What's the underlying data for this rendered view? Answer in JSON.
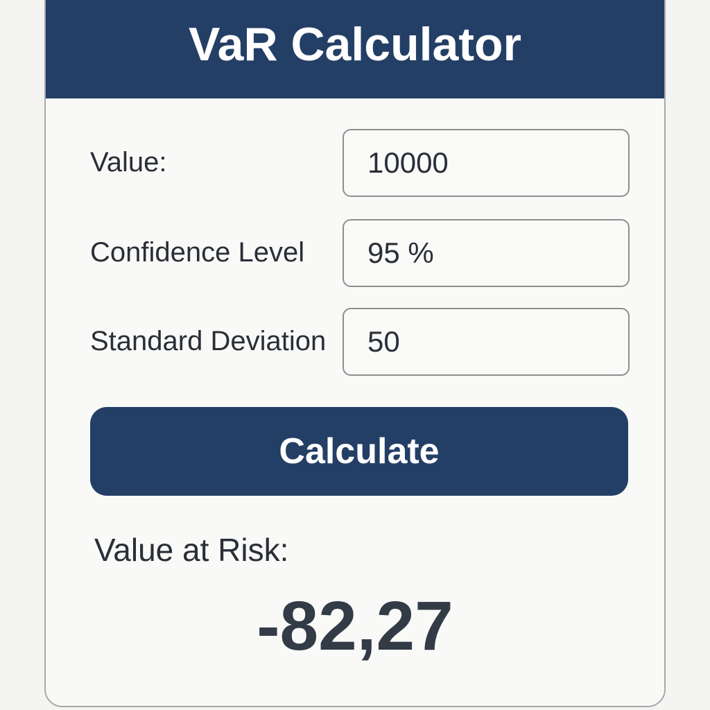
{
  "app": {
    "title": "VaR Calculator"
  },
  "form": {
    "fields": [
      {
        "label": "Value:",
        "value": "10000"
      },
      {
        "label": "Confidence Level",
        "value": "95 %"
      },
      {
        "label": "Standard Deviation",
        "value": "50"
      }
    ],
    "calculate_label": "Calculate"
  },
  "result": {
    "label": "Value at Risk:",
    "value": "-82,27"
  },
  "colors": {
    "header_bg": "#243f66",
    "button_bg": "#243f66",
    "page_bg": "#f4f4f3",
    "card_bg": "#f9f9f8",
    "text": "#2a2e36",
    "result_text": "#333b47"
  }
}
